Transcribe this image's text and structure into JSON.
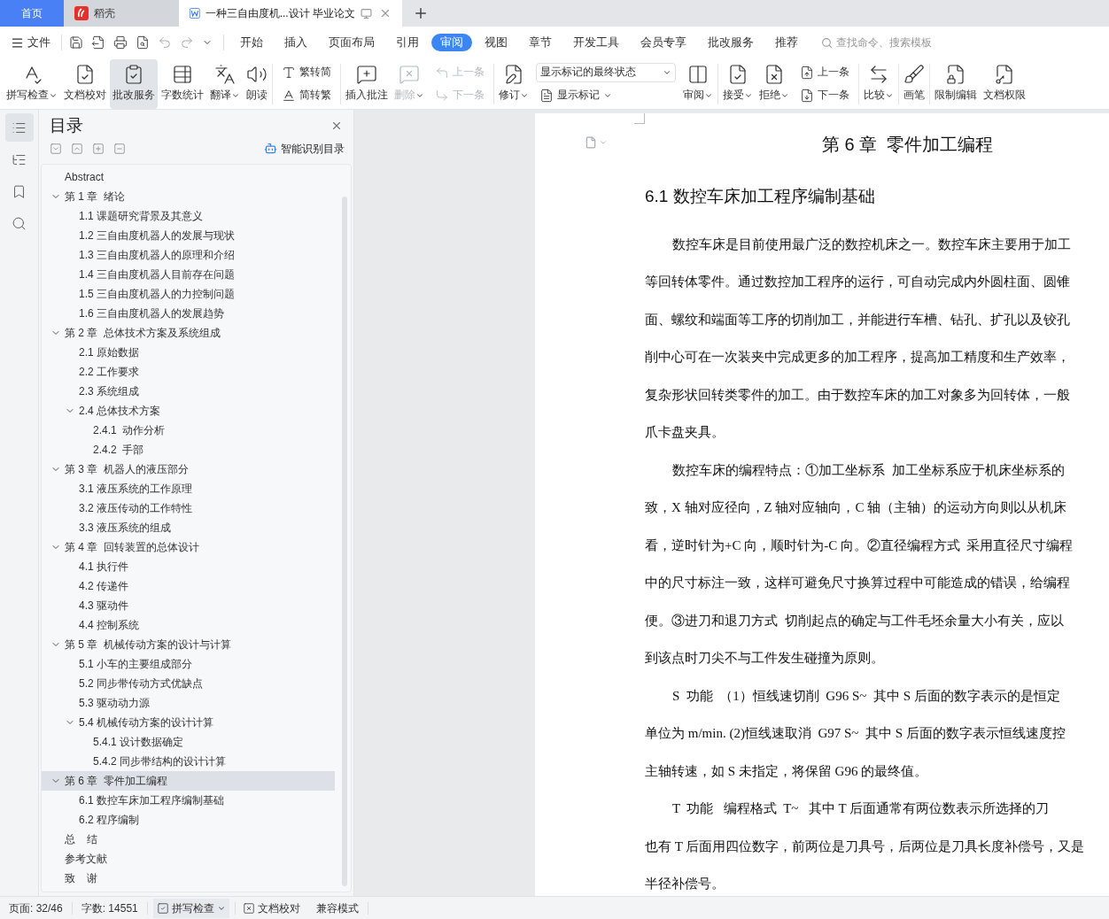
{
  "window_tabs": [
    {
      "kind": "home",
      "label": "首页",
      "selected": false
    },
    {
      "kind": "app",
      "label": "稻壳",
      "selected": false
    },
    {
      "kind": "doc",
      "label": "一种三自由度机...设计 毕业论文",
      "selected": true
    }
  ],
  "menu": {
    "file": "文件",
    "tabs": [
      {
        "label": "开始",
        "selected": false
      },
      {
        "label": "插入",
        "selected": false
      },
      {
        "label": "页面布局",
        "selected": false
      },
      {
        "label": "引用",
        "selected": false
      },
      {
        "label": "审阅",
        "selected": true
      },
      {
        "label": "视图",
        "selected": false
      },
      {
        "label": "章节",
        "selected": false
      },
      {
        "label": "开发工具",
        "selected": false
      },
      {
        "label": "会员专享",
        "selected": false
      },
      {
        "label": "批改服务",
        "selected": false
      },
      {
        "label": "推荐",
        "selected": false
      }
    ],
    "search": {
      "placeholder": "查找命令、搜索模板"
    }
  },
  "ribbon_groups": [
    {
      "items": [
        {
          "kind": "big",
          "label": "拼写检查",
          "dropdown": true,
          "selected": false,
          "disabled": false
        },
        {
          "kind": "big",
          "label": "文档校对",
          "dropdown": false,
          "selected": false,
          "disabled": false
        },
        {
          "kind": "big",
          "label": "批改服务",
          "dropdown": false,
          "selected": true,
          "disabled": false
        },
        {
          "kind": "big",
          "label": "字数统计",
          "dropdown": false,
          "selected": false,
          "disabled": false
        },
        {
          "kind": "big",
          "label": "翻译",
          "dropdown": true,
          "selected": false,
          "disabled": false
        },
        {
          "kind": "big",
          "label": "朗读",
          "dropdown": false,
          "selected": false,
          "disabled": false
        }
      ]
    },
    {
      "items": [
        {
          "kind": "small",
          "label": "繁转简",
          "dropdown": false,
          "selected": false,
          "disabled": false
        },
        {
          "kind": "small",
          "label": "简转繁",
          "dropdown": false,
          "selected": false,
          "disabled": false
        }
      ]
    },
    {
      "items": [
        {
          "kind": "big",
          "label": "插入批注",
          "dropdown": false,
          "selected": false,
          "disabled": false
        },
        {
          "kind": "big",
          "label": "删除",
          "dropdown": true,
          "selected": false,
          "disabled": true
        },
        {
          "kind": "small",
          "label": "上一条",
          "dropdown": false,
          "selected": false,
          "disabled": true
        },
        {
          "kind": "small",
          "label": "下一条",
          "dropdown": false,
          "selected": false,
          "disabled": true
        }
      ]
    },
    {
      "items": [
        {
          "kind": "big",
          "label": "修订",
          "dropdown": true,
          "selected": false,
          "disabled": false
        },
        {
          "kind": "select",
          "label": "显示标记的最终状态",
          "dropdown": true,
          "disabled": false
        },
        {
          "kind": "small",
          "label": "显示标记",
          "dropdown": true,
          "selected": false,
          "disabled": false
        },
        {
          "kind": "big",
          "label": "审阅",
          "dropdown": true,
          "selected": false,
          "disabled": false
        }
      ]
    },
    {
      "items": [
        {
          "kind": "big",
          "label": "接受",
          "dropdown": true,
          "selected": false,
          "disabled": false
        },
        {
          "kind": "big",
          "label": "拒绝",
          "dropdown": true,
          "selected": false,
          "disabled": false
        },
        {
          "kind": "small",
          "label": "上一条",
          "dropdown": false,
          "selected": false,
          "disabled": false
        },
        {
          "kind": "small",
          "label": "下一条",
          "dropdown": false,
          "selected": false,
          "disabled": false
        }
      ]
    },
    {
      "items": [
        {
          "kind": "big",
          "label": "比较",
          "dropdown": true,
          "selected": false,
          "disabled": false
        }
      ]
    },
    {
      "items": [
        {
          "kind": "big",
          "label": "画笔",
          "dropdown": false,
          "selected": false,
          "disabled": false
        }
      ]
    },
    {
      "items": [
        {
          "kind": "big",
          "label": "限制编辑",
          "dropdown": false,
          "selected": false,
          "disabled": false
        },
        {
          "kind": "big",
          "label": "文档权限",
          "dropdown": false,
          "selected": false,
          "disabled": false
        }
      ]
    }
  ],
  "rail": [
    {
      "selected": true
    },
    {
      "selected": false
    },
    {
      "selected": false
    },
    {
      "selected": false
    }
  ],
  "toc": {
    "title": "目录",
    "smart_link": "智能识别目录",
    "items": [
      {
        "label": "Abstract",
        "selected": false
      },
      {
        "label": "第 1 章  绪论",
        "selected": false,
        "expanded": true,
        "children": [
          {
            "label": "1.1 课题研究背景及其意义",
            "selected": false
          },
          {
            "label": "1.2 三自由度机器人的发展与现状",
            "selected": false
          },
          {
            "label": "1.3 三自由度机器人的原理和介绍",
            "selected": false
          },
          {
            "label": "1.4 三自由度机器人目前存在问题",
            "selected": false
          },
          {
            "label": "1.5 三自由度机器人的力控制问题",
            "selected": false
          },
          {
            "label": "1.6 三自由度机器人的发展趋势",
            "selected": false
          }
        ]
      },
      {
        "label": "第 2 章  总体技术方案及系统组成",
        "selected": false,
        "expanded": true,
        "children": [
          {
            "label": "2.1 原始数据",
            "selected": false
          },
          {
            "label": "2.2 工作要求",
            "selected": false
          },
          {
            "label": "2.3 系统组成",
            "selected": false
          },
          {
            "label": "2.4 总体技术方案",
            "selected": false,
            "expanded": true,
            "children": [
              {
                "label": "2.4.1  动作分析",
                "selected": false
              },
              {
                "label": "2.4.2  手部",
                "selected": false
              }
            ]
          }
        ]
      },
      {
        "label": "第 3 章  机器人的液压部分",
        "selected": false,
        "expanded": true,
        "children": [
          {
            "label": "3.1 液压系统的工作原理",
            "selected": false
          },
          {
            "label": "3.2 液压传动的工作特性",
            "selected": false
          },
          {
            "label": "3.3 液压系统的组成",
            "selected": false
          }
        ]
      },
      {
        "label": "第 4 章  回转装置的总体设计",
        "selected": false,
        "expanded": true,
        "children": [
          {
            "label": "4.1 执行件",
            "selected": false
          },
          {
            "label": "4.2 传递件",
            "selected": false
          },
          {
            "label": "4.3 驱动件",
            "selected": false
          },
          {
            "label": "4.4 控制系统",
            "selected": false
          }
        ]
      },
      {
        "label": "第 5 章  机械传动方案的设计与计算",
        "selected": false,
        "expanded": true,
        "children": [
          {
            "label": "5.1 小车的主要组成部分",
            "selected": false
          },
          {
            "label": "5.2 同步带传动方式优缺点",
            "selected": false
          },
          {
            "label": "5.3 驱动动力源",
            "selected": false
          },
          {
            "label": "5.4 机械传动方案的设计计算",
            "selected": false,
            "expanded": true,
            "children": [
              {
                "label": "5.4.1 设计数据确定",
                "selected": false
              },
              {
                "label": "5.4.2 同步带结构的设计计算",
                "selected": false
              }
            ]
          }
        ]
      },
      {
        "label": "第 6 章  零件加工编程",
        "selected": true,
        "expanded": true,
        "children": [
          {
            "label": "6.1 数控车床加工程序编制基础",
            "selected": false
          },
          {
            "label": "6.2 程序编制",
            "selected": false
          }
        ]
      },
      {
        "label": "总    结",
        "selected": false
      },
      {
        "label": "参考文献",
        "selected": false
      },
      {
        "label": "致    谢",
        "selected": false
      }
    ]
  },
  "document": {
    "chapter_title": "第 6 章  零件加工编程",
    "section_title": "6.1 数控车床加工程序编制基础",
    "paragraphs": [
      [
        "数控车床是目前使用最广泛的数控机床之一。数控车床主要用于加工",
        "等回转体零件。通过数控加工程序的运行，可自动完成内外圆柱面、圆锥",
        "面、螺纹和端面等工序的切削加工，并能进行车槽、钻孔、扩孔以及铰孔",
        "削中心可在一次装夹中完成更多的加工程序，提高加工精度和生产效率，",
        "复杂形状回转类零件的加工。由于数控车床的加工对象多为回转体，一般",
        "爪卡盘夹具。"
      ],
      [
        "数控车床的编程特点：①加工坐标系  加工坐标系应于机床坐标系的",
        "致，X 轴对应径向，Z 轴对应轴向，C 轴（主轴）的运动方向则以从机床",
        "看，逆时针为+C 向，顺时针为-C 向。②直径编程方式  采用直径尺寸编程",
        "中的尺寸标注一致，这样可避免尺寸换算过程中可能造成的错误，给编程",
        "便。③进刀和退刀方式  切削起点的确定与工件毛坯余量大小有关，应以",
        "到该点时刀尖不与工件发生碰撞为原则。"
      ],
      [
        "S  功能  （1）恒线速切削  G96 S~  其中 S 后面的数字表示的是恒定",
        "单位为 m/min. (2)恒线速取消  G97 S~  其中 S 后面的数字表示恒线速度控",
        "主轴转速，如 S 未指定，将保留 G96 的最终值。"
      ],
      [
        "T  功能   编程格式  T~   其中 T 后面通常有两位数表示所选择的刀",
        "也有 T 后面用四位数字，前两位是刀具号，后两位是刀具长度补偿号，又是",
        "半径补偿号。"
      ]
    ]
  },
  "status_bar": {
    "page": "页面: 32/46",
    "words": "字数: 14551",
    "spell": {
      "label": "拼写检查",
      "dropdown": true
    },
    "proof": "文档校对",
    "mode": "兼容模式"
  }
}
